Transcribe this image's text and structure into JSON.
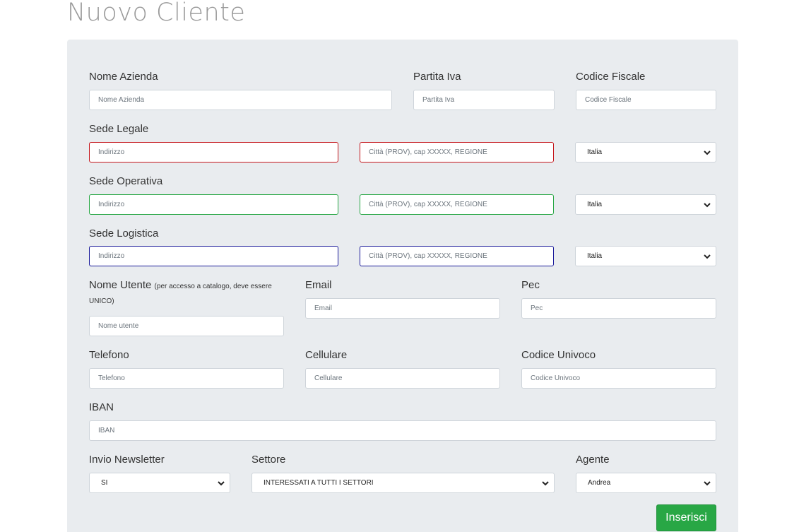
{
  "page": {
    "title": "Nuovo Cliente"
  },
  "labels": {
    "nome_azienda": "Nome Azienda",
    "partita_iva": "Partita Iva",
    "codice_fiscale": "Codice Fiscale",
    "sede_legale": "Sede Legale",
    "sede_operativa": "Sede Operativa",
    "sede_logistica": "Sede Logistica",
    "nome_utente": "Nome Utente",
    "nome_utente_note_1": "(per accesso a catalogo, deve essere",
    "nome_utente_note_2": "UNICO)",
    "email": "Email",
    "pec": "Pec",
    "telefono": "Telefono",
    "cellulare": "Cellulare",
    "codice_univoco": "Codice Univoco",
    "iban": "IBAN",
    "invio_newsletter": "Invio Newsletter",
    "settore": "Settore",
    "agente": "Agente"
  },
  "placeholders": {
    "nome_azienda": "Nome Azienda",
    "partita_iva": "Partita Iva",
    "codice_fiscale": "Codice Fiscale",
    "indirizzo": "Indirizzo",
    "citta": "Città (PROV), cap XXXXX, REGIONE",
    "nome_utente": "Nome utente",
    "email": "Email",
    "pec": "Pec",
    "telefono": "Telefono",
    "cellulare": "Cellulare",
    "codice_univoco": "Codice Univoco",
    "iban": "IBAN"
  },
  "selects": {
    "paese_legale": "Italia",
    "paese_operativa": "Italia",
    "paese_logistica": "Italia",
    "newsletter": "SI",
    "settore": "INTERESSATI A TUTTI I SETTORI",
    "agente": "Andrea"
  },
  "actions": {
    "submit": "Inserisci"
  },
  "colors": {
    "legale_border": "#c4161c",
    "operativa_border": "#28a745",
    "logistica_border": "#1a1a9a",
    "submit_bg": "#28a745"
  }
}
